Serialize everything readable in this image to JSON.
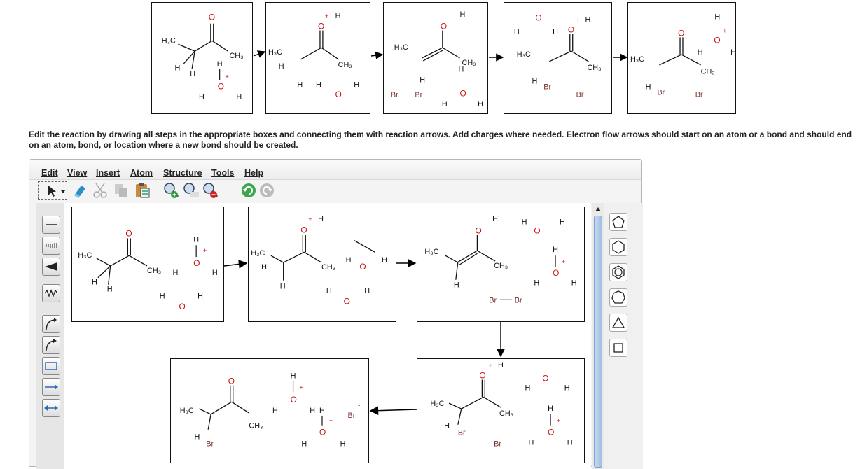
{
  "instructions": "Edit the reaction by drawing all steps in the appropriate boxes and connecting them with reaction arrows. Add charges where needed. Electron flow arrows should start on an atom or a bond and should end on an atom, bond, or location where a new bond should be created.",
  "menu": {
    "items": [
      "Edit",
      "View",
      "Insert",
      "Atom",
      "Structure",
      "Tools",
      "Help"
    ]
  },
  "labels": {
    "O": "O",
    "H": "H",
    "H3C": "H₃C",
    "CH3": "CH₃",
    "Br": "Br",
    "plus": "+",
    "minus": "-"
  },
  "colors": {
    "oxygen": "#cc1111",
    "bromine": "#7a2f2f",
    "bond": "#111111",
    "arrow": "#000000"
  },
  "icons": {
    "toolbar": [
      "select-arrow-icon",
      "eraser-icon",
      "cut-icon",
      "copy-icon",
      "paste-icon",
      "zoom-in-icon",
      "zoom-all-icon",
      "zoom-out-icon",
      "undo-icon",
      "redo-icon"
    ],
    "left": [
      "single-bond-icon",
      "hash-bond-icon",
      "wedge-bond-icon",
      "wavy-bond-icon",
      "curved-arrow-single-icon",
      "curved-arrow-double-icon",
      "text-box-icon",
      "reaction-arrow-icon",
      "equilibrium-arrow-icon"
    ],
    "right": [
      "cyclopentane-icon",
      "cyclohexane-icon",
      "benzene-icon",
      "cycloheptane-icon",
      "triangle-icon",
      "square-icon"
    ]
  }
}
